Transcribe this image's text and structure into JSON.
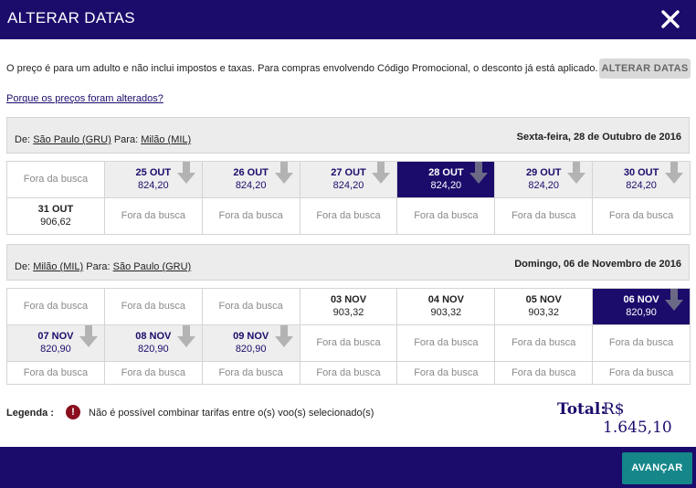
{
  "modal": {
    "title": "ALTERAR DATAS",
    "close_icon": "close-icon"
  },
  "info_text": "O preço é para um adulto e não inclui impostos e taxas. Para compras envolvendo Código Promocional, o desconto já está aplicado.",
  "alter_button_label": "ALTERAR DATAS",
  "price_link": "Porque os preços foram alterados?",
  "legs": [
    {
      "from_label": "De:",
      "from_city": "São Paulo (GRU)",
      "to_label": "Para:",
      "to_city": "Milão (MIL)",
      "date_label": "Sexta-feira, 28 de Outubro de 2016"
    },
    {
      "from_label": "De:",
      "from_city": "Milão (MIL)",
      "to_label": "Para:",
      "to_city": "São Paulo (GRU)",
      "date_label": "Domingo, 06 de Novembro de 2016"
    }
  ],
  "grid1": [
    [
      {
        "type": "off",
        "text": "Fora da busca"
      },
      {
        "type": "promo",
        "date": "25 OUT",
        "price": "824,20"
      },
      {
        "type": "promo",
        "date": "26 OUT",
        "price": "824,20"
      },
      {
        "type": "promo",
        "date": "27 OUT",
        "price": "824,20"
      },
      {
        "type": "selected",
        "date": "28 OUT",
        "price": "824,20"
      },
      {
        "type": "promo",
        "date": "29 OUT",
        "price": "824,20"
      },
      {
        "type": "promo",
        "date": "30 OUT",
        "price": "824,20"
      }
    ],
    [
      {
        "type": "avail",
        "date": "31 OUT",
        "price": "906,62"
      },
      {
        "type": "off",
        "text": "Fora da busca"
      },
      {
        "type": "off",
        "text": "Fora da busca"
      },
      {
        "type": "off",
        "text": "Fora da busca"
      },
      {
        "type": "off",
        "text": "Fora da busca"
      },
      {
        "type": "off",
        "text": "Fora da busca"
      },
      {
        "type": "off",
        "text": "Fora da busca"
      }
    ]
  ],
  "grid2": [
    [
      {
        "type": "off",
        "text": "Fora da busca"
      },
      {
        "type": "off",
        "text": "Fora da busca"
      },
      {
        "type": "off",
        "text": "Fora da busca"
      },
      {
        "type": "avail",
        "date": "03 NOV",
        "price": "903,32"
      },
      {
        "type": "avail",
        "date": "04 NOV",
        "price": "903,32"
      },
      {
        "type": "avail",
        "date": "05 NOV",
        "price": "903,32"
      },
      {
        "type": "selected",
        "date": "06 NOV",
        "price": "820,90"
      }
    ],
    [
      {
        "type": "promo",
        "date": "07 NOV",
        "price": "820,90"
      },
      {
        "type": "promo",
        "date": "08 NOV",
        "price": "820,90"
      },
      {
        "type": "promo",
        "date": "09 NOV",
        "price": "820,90"
      },
      {
        "type": "off",
        "text": "Fora da busca"
      },
      {
        "type": "off",
        "text": "Fora da busca"
      },
      {
        "type": "off",
        "text": "Fora da busca"
      },
      {
        "type": "off",
        "text": "Fora da busca"
      }
    ],
    [
      {
        "type": "off",
        "text": "Fora da busca"
      },
      {
        "type": "off",
        "text": "Fora da busca"
      },
      {
        "type": "off",
        "text": "Fora da busca"
      },
      {
        "type": "off",
        "text": "Fora da busca"
      },
      {
        "type": "off",
        "text": "Fora da busca"
      },
      {
        "type": "off",
        "text": "Fora da busca"
      },
      {
        "type": "off",
        "text": "Fora da busca"
      }
    ]
  ],
  "legend": {
    "label": "Legenda :",
    "icon": "!",
    "text": "Não é possível combinar tarifas entre o(s) voo(s) selecionado(s)"
  },
  "total": {
    "label": "Total:",
    "value": "R$ 1.645,10"
  },
  "advance_button_label": "AVANÇAR",
  "colors": {
    "brand": "#1b0b6b",
    "button": "#15878a",
    "alert": "#8a0f1e",
    "promo_cell": "#eeeeee"
  }
}
